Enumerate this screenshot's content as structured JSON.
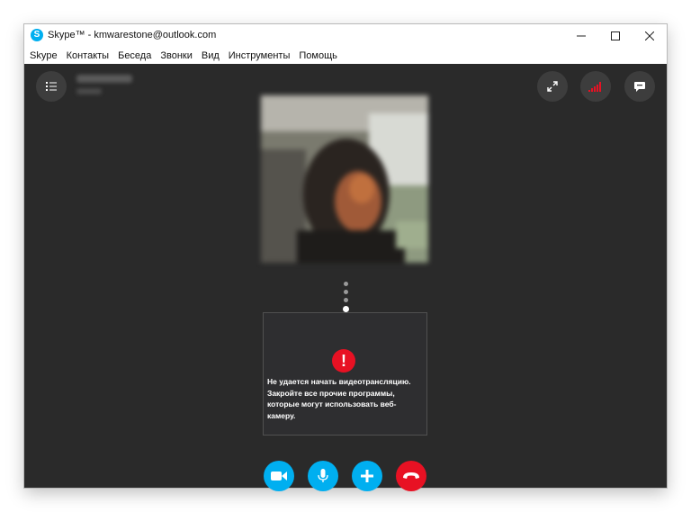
{
  "window": {
    "title": "Skype™ - kmwarestone@outlook.com",
    "controls": {
      "minimize": "—",
      "maximize": "☐",
      "close": "✕"
    }
  },
  "menu": {
    "items": [
      "Skype",
      "Контакты",
      "Беседа",
      "Звонки",
      "Вид",
      "Инструменты",
      "Помощь"
    ]
  },
  "call": {
    "progress_dots": [
      false,
      false,
      false,
      true,
      false
    ],
    "video_error": {
      "message": "Не удается начать видеотрансляцию. Закройте все прочие программы, которые могут использовать веб-камеру."
    },
    "controls": {
      "video": {
        "icon": "video-camera-icon",
        "color": "#00aff0"
      },
      "mic": {
        "icon": "microphone-icon",
        "color": "#00aff0"
      },
      "add": {
        "icon": "plus-icon",
        "color": "#00aff0"
      },
      "hangup": {
        "icon": "hang-up-icon",
        "color": "#e81123"
      }
    }
  },
  "colors": {
    "accent": "#00aff0",
    "danger": "#e81123",
    "stage": "#2a2a2a",
    "signal": "#e81123"
  }
}
